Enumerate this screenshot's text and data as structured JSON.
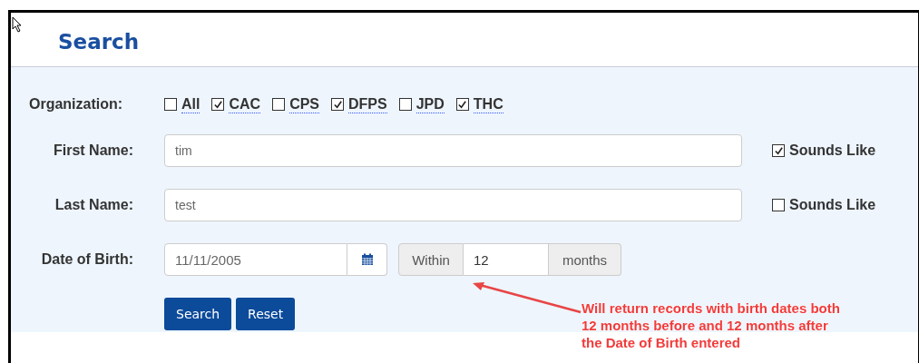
{
  "title": "Search",
  "organization": {
    "label": "Organization:",
    "options": [
      {
        "label": "All",
        "checked": false
      },
      {
        "label": "CAC",
        "checked": true
      },
      {
        "label": "CPS",
        "checked": false
      },
      {
        "label": "DFPS",
        "checked": true
      },
      {
        "label": "JPD",
        "checked": false
      },
      {
        "label": "THC",
        "checked": true
      }
    ]
  },
  "name_fields": [
    {
      "label": "First Name:",
      "value": "tim",
      "sounds_like": {
        "label": "Sounds Like",
        "checked": true
      }
    },
    {
      "label": "Last Name:",
      "value": "test",
      "sounds_like": {
        "label": "Sounds Like",
        "checked": false
      }
    }
  ],
  "date_of_birth": {
    "label": "Date of Birth:",
    "value": "11/11/2005",
    "within_label": "Within",
    "within_value": "12",
    "unit": "months"
  },
  "buttons": [
    "Search",
    "Reset"
  ],
  "annotation": {
    "lines": [
      "Will return records with birth dates both",
      "12 months before and 12 months after",
      "the Date of Birth entered"
    ]
  }
}
